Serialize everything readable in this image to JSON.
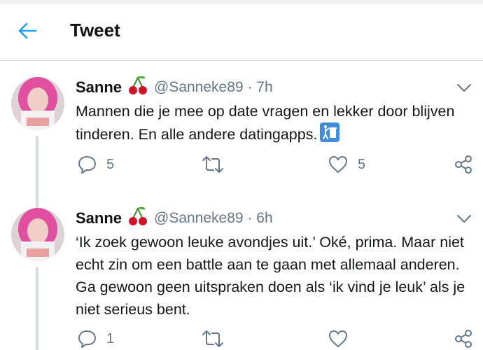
{
  "header": {
    "title": "Tweet"
  },
  "tweets": [
    {
      "name": "Sanne",
      "handle": "@Sanneke89",
      "time": "7h",
      "text": "Mannen die je mee op date vragen en lekker door blijven tinderen. En alle andere datingapps.",
      "reply_count": "5",
      "like_count": "5"
    },
    {
      "name": "Sanne",
      "handle": "@Sanneke89",
      "time": "6h",
      "text": "‘Ik zoek gewoon leuke avondjes uit.’ Oké, prima. Maar niet echt zin om een battle aan te gaan met allemaal anderen. Ga gewoon geen uitspraken doen als ‘ik vind je leuk’ als je niet serieus bent.",
      "reply_count": "1",
      "like_count": ""
    }
  ],
  "icons": {
    "back": "arrow-left-icon",
    "emoji": "put-litter-in-bin-emoji",
    "badge": "cherries-emoji"
  },
  "colors": {
    "accent": "#1da1f2",
    "secondary_text": "#657786",
    "thread_line": "#d4dbe1"
  }
}
